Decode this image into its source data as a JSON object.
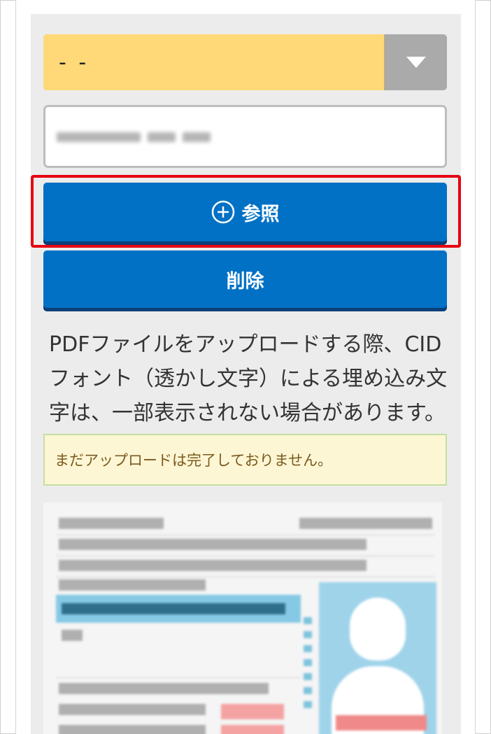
{
  "select": {
    "value": "- -"
  },
  "file": {
    "name_blurred": ""
  },
  "buttons": {
    "browse": "参照",
    "delete": "削除"
  },
  "note": "PDFファイルをアップロードする際、CIDフォント（透かし文字）による埋め込み文字は、一部表示されない場合があります。",
  "alert": "まだアップロードは完了しておりません。",
  "icons": {
    "select_arrow": "chevron-down-icon",
    "browse": "plus-circle-icon"
  },
  "colors": {
    "select_bg": "#ffd978",
    "button_bg": "#0071c5",
    "highlight_border": "#e60012",
    "alert_bg": "#fdf6d4"
  }
}
